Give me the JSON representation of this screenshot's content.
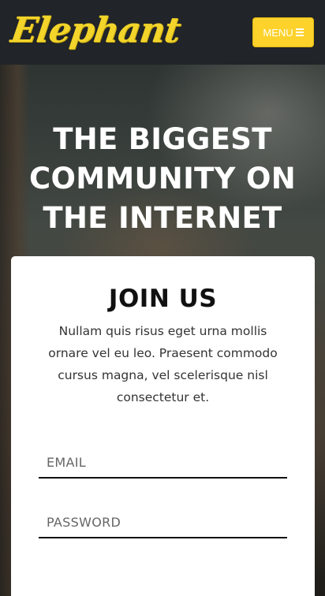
{
  "header": {
    "logo_text": "Elephant",
    "menu_label": "MENU",
    "menu_icon": "hamburger-icon",
    "brand_color": "#fdd22b",
    "nav_bg": "#212428"
  },
  "hero": {
    "title": "THE BIGGEST COMMUNITY ON THE INTERNET"
  },
  "signup": {
    "title": "JOIN US",
    "description": "Nullam quis risus eget urna mollis ornare vel eu leo. Praesent commodo cursus magna, vel scelerisque nisl consectetur et.",
    "email_placeholder": "EMAIL",
    "email_value": "",
    "password_placeholder": "PASSWORD",
    "password_value": ""
  }
}
